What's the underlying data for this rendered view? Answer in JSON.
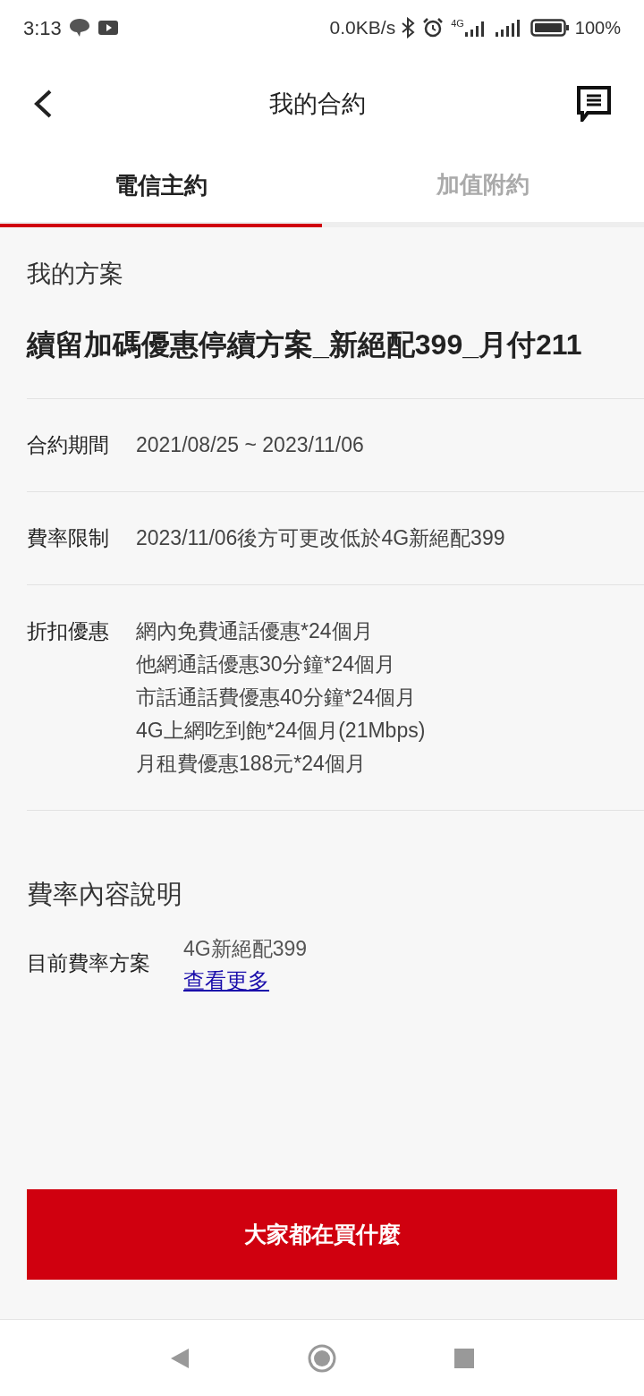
{
  "status_bar": {
    "time": "3:13",
    "speed": "0.0KB/s",
    "network": "4G",
    "battery": "100%"
  },
  "header": {
    "title": "我的合約"
  },
  "tabs": [
    {
      "label": "電信主約",
      "selected": true
    },
    {
      "label": "加值附約",
      "selected": false
    }
  ],
  "plan": {
    "heading": "我的方案",
    "name": "續留加碼優惠停續方案_新絕配399_月付211"
  },
  "details": [
    {
      "label": "合約期間",
      "lines": [
        "2021/08/25 ~ 2023/11/06"
      ]
    },
    {
      "label": "費率限制",
      "lines": [
        "2023/11/06後方可更改低於4G新絕配399"
      ]
    },
    {
      "label": "折扣優惠",
      "lines": [
        "網內免費通話優惠*24個月",
        "他網通話優惠30分鐘*24個月",
        "市話通話費優惠40分鐘*24個月",
        "4G上網吃到飽*24個月(21Mbps)",
        "月租費優惠188元*24個月"
      ]
    }
  ],
  "rate_info": {
    "heading": "費率內容說明",
    "label": "目前費率方案",
    "value": "4G新絕配399",
    "link": "查看更多"
  },
  "action_button": "大家都在買什麼"
}
